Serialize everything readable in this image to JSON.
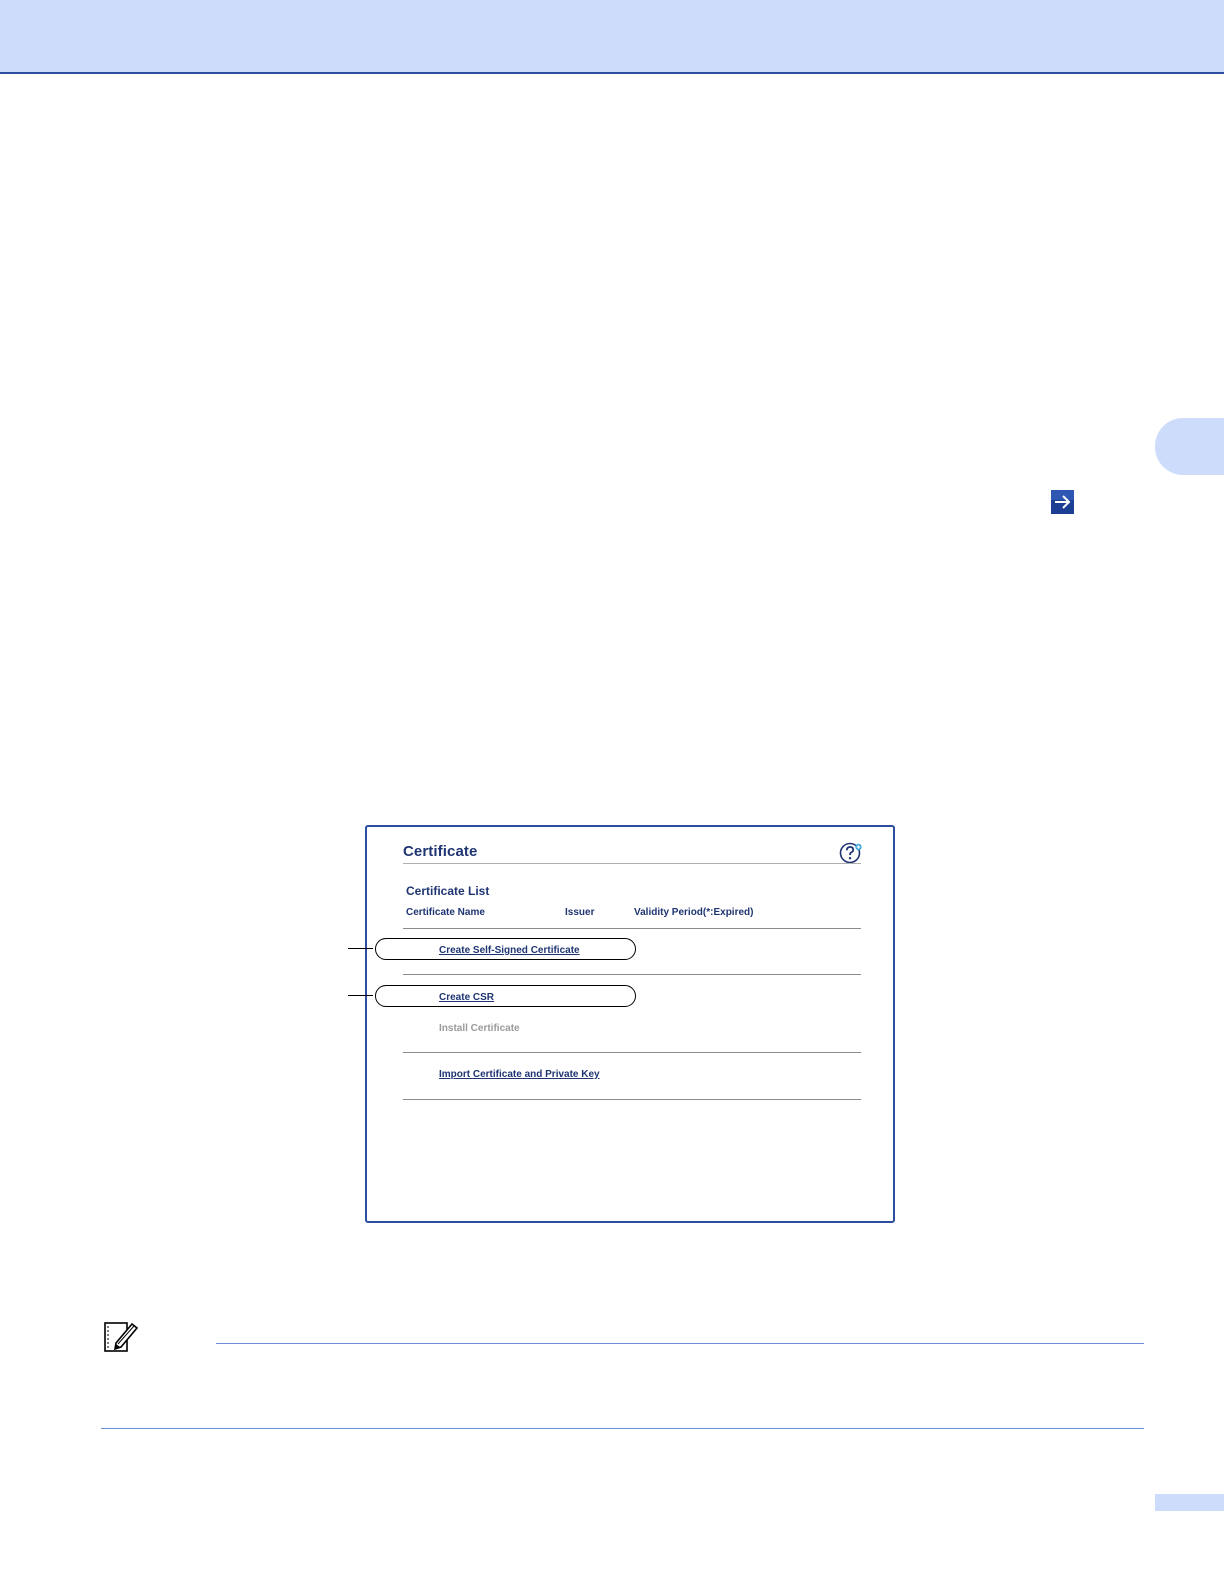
{
  "certificate_window": {
    "title": "Certificate",
    "list_heading": "Certificate List",
    "columns": [
      "Certificate Name",
      "Issuer",
      "Validity Period(*:Expired)"
    ],
    "links": {
      "create_self_signed": "Create Self-Signed Certificate",
      "create_csr": "Create CSR",
      "install_certificate": "Install Certificate",
      "import_certificate": "Import Certificate and Private Key"
    }
  },
  "icons": {
    "continue": "arrow-right-icon",
    "help": "help-icon",
    "note": "note-pencil-icon"
  },
  "colors": {
    "header_band": "#cddcfb",
    "accent_blue": "#2d4ea0",
    "text_navy": "#1f3572"
  }
}
